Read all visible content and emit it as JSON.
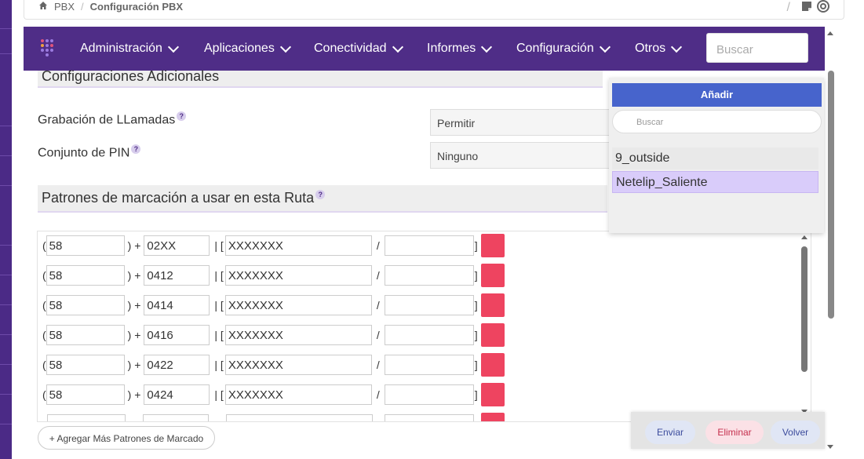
{
  "breadcrumb": {
    "home": "PBX",
    "current": "Configuración PBX"
  },
  "navbar": {
    "items": [
      "Administración",
      "Aplicaciones",
      "Conectividad",
      "Informes",
      "Configuración",
      "Otros"
    ],
    "search_placeholder": "Buscar"
  },
  "section_additional": {
    "title": "Configuraciones Adicionales"
  },
  "fields": [
    {
      "label": "Grabación de LLamadas",
      "value": "Permitir"
    },
    {
      "label": "Conjunto de PIN",
      "value": "Ninguno"
    }
  ],
  "section_patterns": {
    "title": "Patrones de marcación a usar en esta Ruta"
  },
  "patterns": [
    {
      "prepend": "58",
      "prefix": "02XX",
      "match": "XXXXXXX",
      "callerid": ""
    },
    {
      "prepend": "58",
      "prefix": "0412",
      "match": "XXXXXXX",
      "callerid": ""
    },
    {
      "prepend": "58",
      "prefix": "0414",
      "match": "XXXXXXX",
      "callerid": ""
    },
    {
      "prepend": "58",
      "prefix": "0416",
      "match": "XXXXXXX",
      "callerid": ""
    },
    {
      "prepend": "58",
      "prefix": "0422",
      "match": "XXXXXXX",
      "callerid": ""
    },
    {
      "prepend": "58",
      "prefix": "0424",
      "match": "XXXXXXX",
      "callerid": ""
    }
  ],
  "symbols": {
    "open_paren": "(",
    "close_paren_plus": ") +",
    "pipe_bracket": "| [",
    "slash": "/",
    "close_bracket": "]"
  },
  "add_patterns_label": "+ Agregar Más Patrones de Marcado",
  "dropdown": {
    "add_label": "Añadir",
    "search_placeholder": "Buscar",
    "items": [
      "9_outside",
      "Netelip_Saliente"
    ]
  },
  "footer": {
    "submit": "Enviar",
    "delete": "Eliminar",
    "back": "Volver"
  },
  "colors": {
    "navbar": "#4f2d87",
    "delete_row": "#ee4460",
    "add_button": "#4764cc",
    "selected_item": "#d9ccfa"
  }
}
